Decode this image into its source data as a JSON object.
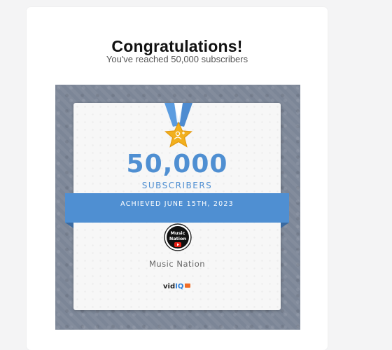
{
  "header": {
    "title": "Congratulations!",
    "subtitle": "You've reached 50,000 subscribers"
  },
  "badge": {
    "count": "50,000",
    "unit": "SUBSCRIBERS",
    "achieved": "ACHIEVED JUNE 15TH, 2023",
    "channel_name": "Music Nation",
    "brand_prefix": "vid",
    "brand_suffix": "IQ",
    "accent_color": "#4f8fd2",
    "medal_color": "#f2b01e",
    "ribbon_color": "#4f8fd2",
    "frame_color": "#7c8697",
    "logo_lines": [
      "Music",
      "Nation"
    ]
  }
}
